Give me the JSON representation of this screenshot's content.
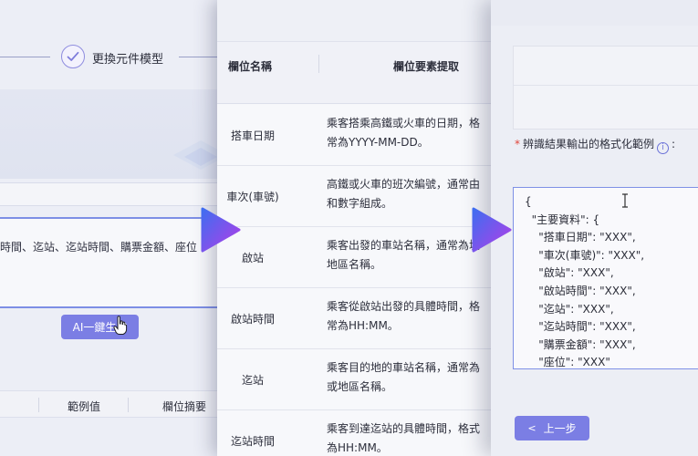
{
  "accent": "#7b7ee4",
  "left_panel": {
    "stepper_label": "更換元件模型",
    "textarea_text": "時間、迄站、迄站時間、購票金額、座位",
    "ai_button": "AI一鍵生成",
    "table_headers": [
      "範例值",
      "欄位摘要"
    ]
  },
  "middle_panel": {
    "headers": {
      "field_name": "欄位名稱",
      "extraction": "欄位要素提取"
    },
    "rows": [
      {
        "name": "搭車日期",
        "desc": "乘客搭乘高鐵或火車的日期，格\n常為YYYY-MM-DD。"
      },
      {
        "name": "車次(車號)",
        "desc": "高鐵或火車的班次編號，通常由\n和數字組成。"
      },
      {
        "name": "啟站",
        "desc": "乘客出發的車站名稱，通常為城\n地區名稱。"
      },
      {
        "name": "啟站時間",
        "desc": "乘客從啟站出發的具體時間，格\n常為HH:MM。"
      },
      {
        "name": "迄站",
        "desc": "乘客目的地的車站名稱，通常為\n或地區名稱。"
      },
      {
        "name": "迄站時間",
        "desc": "乘客到達迄站的具體時間，格式\n為HH:MM。"
      }
    ]
  },
  "right_panel": {
    "required_mark": "*",
    "format_label": "辨識結果輸出的格式化範例",
    "info_icon": "i",
    "colon": ":",
    "code": "{\n  \"主要資料\": {\n    \"搭車日期\": \"XXX\",\n    \"車次(車號)\": \"XXX\",\n    \"啟站\": \"XXX\",\n    \"啟站時間\": \"XXX\",\n    \"迄站\": \"XXX\",\n    \"迄站時間\": \"XXX\",\n    \"購票金額\": \"XXX\",\n    \"座位\": \"XXX\"",
    "prev_button": "上一步",
    "prev_chevron": "<"
  }
}
